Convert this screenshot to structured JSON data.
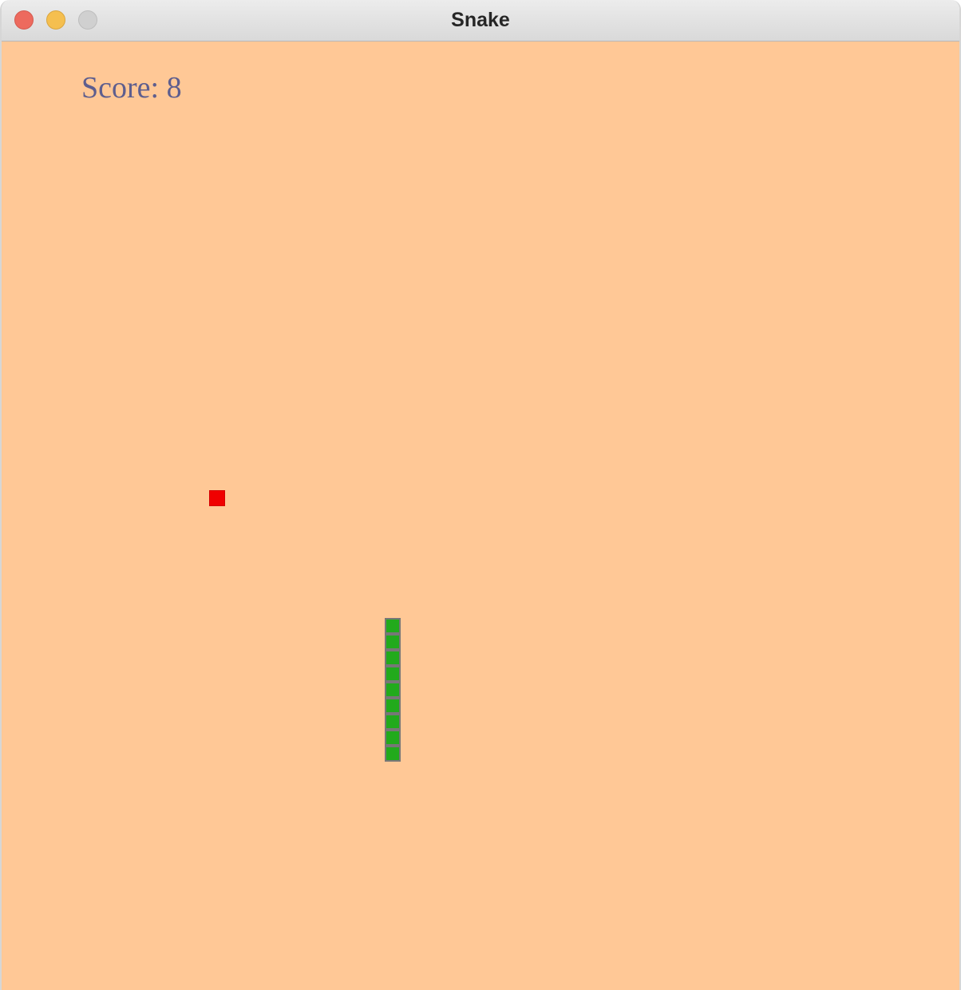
{
  "window": {
    "title": "Snake"
  },
  "game": {
    "score_label": "Score: 8",
    "score": 8,
    "grid_cell_size": 20,
    "food": {
      "col": 13,
      "row": 28
    },
    "snake": {
      "direction": "up",
      "segments": [
        {
          "col": 24,
          "row": 36
        },
        {
          "col": 24,
          "row": 37
        },
        {
          "col": 24,
          "row": 38
        },
        {
          "col": 24,
          "row": 39
        },
        {
          "col": 24,
          "row": 40
        },
        {
          "col": 24,
          "row": 41
        },
        {
          "col": 24,
          "row": 42
        },
        {
          "col": 24,
          "row": 43
        },
        {
          "col": 24,
          "row": 44
        }
      ]
    }
  },
  "colors": {
    "background": "#ffc896",
    "score_text": "#5e5e8e",
    "food": "#f00000",
    "snake_fill": "#22aa1c",
    "snake_border": "#777777"
  }
}
